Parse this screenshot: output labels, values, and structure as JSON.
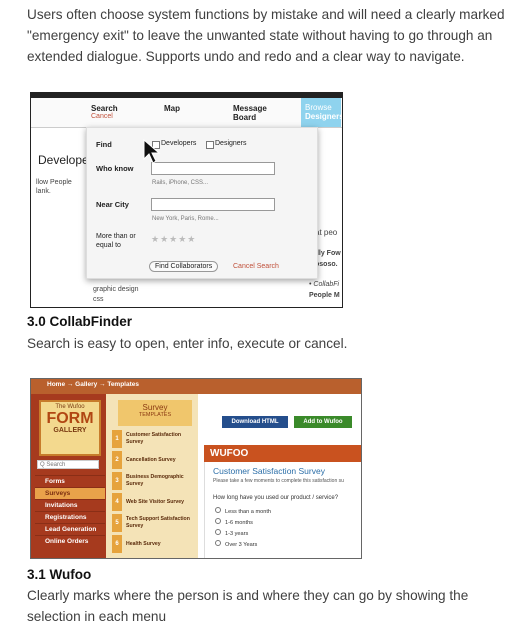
{
  "intro_text": "Users often choose system functions by mistake and will need a clearly marked \"emergency exit\" to leave the unwanted state without having to go through an extended dialogue. Supports undo and redo and a clear way to navigate.",
  "fig1": {
    "tabs": {
      "search": "Search",
      "cancel": "Cancel",
      "map": "Map",
      "message": "Message Board",
      "browse_line1": "Browse",
      "browse_line2": "Designers"
    },
    "background": {
      "developers": "Develope",
      "people_a": "llow People",
      "people_b": "lank.",
      "graphic": "graphic design",
      "css": "css",
      "at_peo": "at peo",
      "illy": "illy Fow",
      "ososo": "ososo.",
      "collab": "• CollabFi",
      "people_m": "People M"
    },
    "panel": {
      "find_label": "Find",
      "opt_developers": "Developers",
      "opt_designers": "Designers",
      "who_label": "Who know",
      "who_hint": "Rails, iPhone, CSS...",
      "city_label": "Near City",
      "city_hint": "New York, Paris, Rome...",
      "more_label": "More than or equal to",
      "stars": "★★★★★",
      "find_button": "Find Collaborators",
      "cancel_search": "Cancel Search"
    }
  },
  "caption1_title": "3.0 CollabFinder",
  "caption1_text": "Search is easy to open, enter info, execute or cancel.",
  "fig2": {
    "breadcrumb": "Home → Gallery → Templates",
    "logo": {
      "line1": "The Wufoo",
      "line2": "FORM",
      "line3": "GALLERY"
    },
    "search_placeholder": "Q Search",
    "nav": [
      "Forms",
      "Surveys",
      "Invitations",
      "Registrations",
      "Lead Generation",
      "Online Orders"
    ],
    "active_nav": 1,
    "survey_title": "Survey",
    "survey_sub": "TEMPLATES",
    "templates": [
      {
        "num": "1",
        "label": "Customer Satisfaction Survey"
      },
      {
        "num": "2",
        "label": "Cancellation Survey"
      },
      {
        "num": "3",
        "label": "Business Demographic Survey"
      },
      {
        "num": "4",
        "label": "Web Site Visitor Survey"
      },
      {
        "num": "5",
        "label": "Tech Support Satisfaction Survey"
      },
      {
        "num": "6",
        "label": "Health Survey"
      }
    ],
    "download_button": "Download HTML",
    "add_button": "Add to Wufoo",
    "wufoo_brand": "WUFOO",
    "form_title": "Customer Satisfaction Survey",
    "form_subtitle": "Please take a few moments to complete this satisfaction su",
    "question": "How long have you used our product / service?",
    "options": [
      "Less than a month",
      "1-6 months",
      "1-3 years",
      "Over 3 Years"
    ]
  },
  "caption2_title": "3.1 Wufoo",
  "caption2_text": "Clearly marks where the person is and where they can go by showing the selection in each menu"
}
